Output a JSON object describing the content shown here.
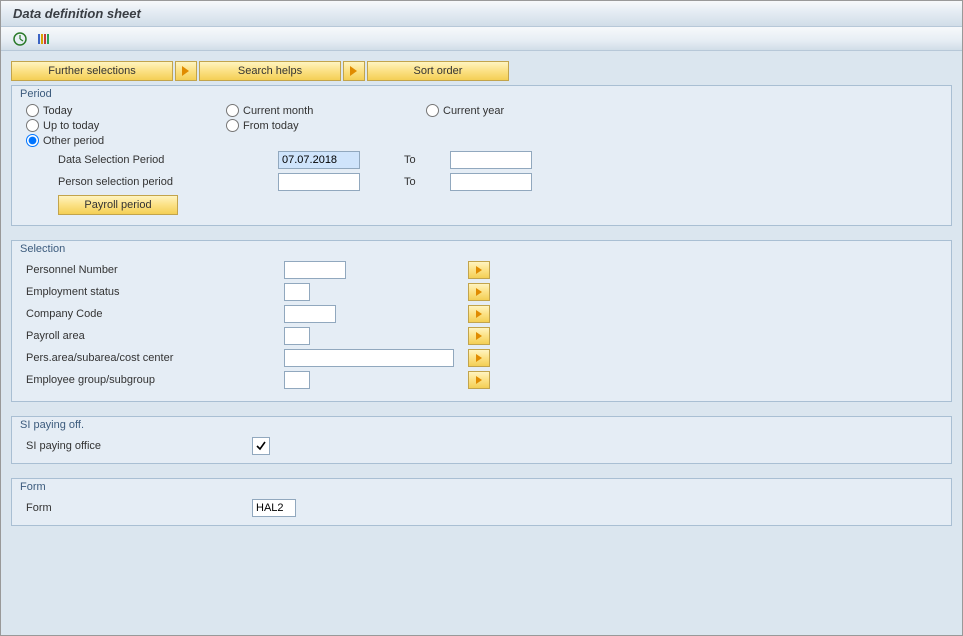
{
  "title": "Data definition sheet",
  "toolbar": {
    "further_selections": "Further selections",
    "search_helps": "Search helps",
    "sort_order": "Sort order"
  },
  "period": {
    "group_label": "Period",
    "radios": {
      "today": "Today",
      "current_month": "Current month",
      "current_year": "Current year",
      "up_to_today": "Up to today",
      "from_today": "From today",
      "other_period": "Other period"
    },
    "selected": "other_period",
    "data_selection_period_label": "Data Selection Period",
    "data_selection_period_from": "07.07.2018",
    "data_selection_period_to_label": "To",
    "data_selection_period_to": "",
    "person_selection_period_label": "Person selection period",
    "person_selection_period_from": "",
    "person_selection_period_to_label": "To",
    "person_selection_period_to": "",
    "payroll_period_button": "Payroll period"
  },
  "selection": {
    "group_label": "Selection",
    "rows": {
      "personnel_number": {
        "label": "Personnel Number",
        "value": ""
      },
      "employment_status": {
        "label": "Employment status",
        "value": ""
      },
      "company_code": {
        "label": "Company Code",
        "value": ""
      },
      "payroll_area": {
        "label": "Payroll area",
        "value": ""
      },
      "pers_area": {
        "label": "Pers.area/subarea/cost center",
        "value": ""
      },
      "employee_group": {
        "label": "Employee group/subgroup",
        "value": ""
      }
    }
  },
  "si_paying": {
    "group_label": "SI paying off.",
    "row_label": "SI paying office",
    "checked": true
  },
  "form": {
    "group_label": "Form",
    "row_label": "Form",
    "value": "HAL2"
  }
}
